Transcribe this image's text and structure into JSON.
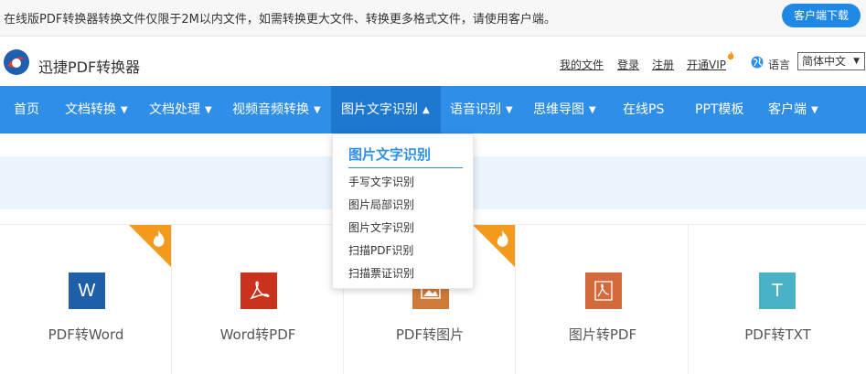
{
  "notice": {
    "text": "在线版PDF转换器转换文件仅限于2M以内文件，如需转换更大文件、转换更多格式文件，请使用客户端。",
    "download_button": "客户端下载"
  },
  "header": {
    "brand": "迅捷PDF转换器",
    "links": [
      "我的文件",
      "登录",
      "注册",
      "开通VIP"
    ],
    "language_label": "语言",
    "language_value": "简体中文"
  },
  "nav": {
    "items": [
      {
        "label": "首页",
        "caret": ""
      },
      {
        "label": "文档转换",
        "caret": "▼"
      },
      {
        "label": "文档处理",
        "caret": "▼"
      },
      {
        "label": "视频音频转换",
        "caret": "▼"
      },
      {
        "label": "图片文字识别",
        "caret": "▲"
      },
      {
        "label": "语音识别",
        "caret": "▼"
      },
      {
        "label": "思维导图",
        "caret": "▼"
      },
      {
        "label": "在线PS",
        "caret": ""
      },
      {
        "label": "PPT模板",
        "caret": ""
      },
      {
        "label": "客户端",
        "caret": "▼"
      }
    ]
  },
  "dropdown": {
    "title": "图片文字识别",
    "items": [
      "手写文字识别",
      "图片局部识别",
      "图片文字识别",
      "扫描PDF识别",
      "扫描票证识别"
    ]
  },
  "cards": [
    {
      "label": "PDF转Word",
      "icon": "W",
      "icon_name": "word-icon",
      "color": "#1f5fa8",
      "hot": true
    },
    {
      "label": "Word转PDF",
      "icon": "pdf",
      "icon_name": "pdf-icon",
      "color": "#c9331e",
      "hot": false
    },
    {
      "label": "PDF转图片",
      "icon": "img",
      "icon_name": "image-icon",
      "color": "#d07a3a",
      "hot": true
    },
    {
      "label": "图片转PDF",
      "icon": "pdf",
      "icon_name": "pdf-icon",
      "color": "#d36a3c",
      "hot": false
    },
    {
      "label": "PDF转TXT",
      "icon": "T",
      "icon_name": "txt-icon",
      "color": "#4ab1c6",
      "hot": false
    }
  ],
  "colors": {
    "nav_bg": "#2e8ee8",
    "nav_active": "#1f78cf",
    "hot_ribbon": "#f39a1c"
  }
}
